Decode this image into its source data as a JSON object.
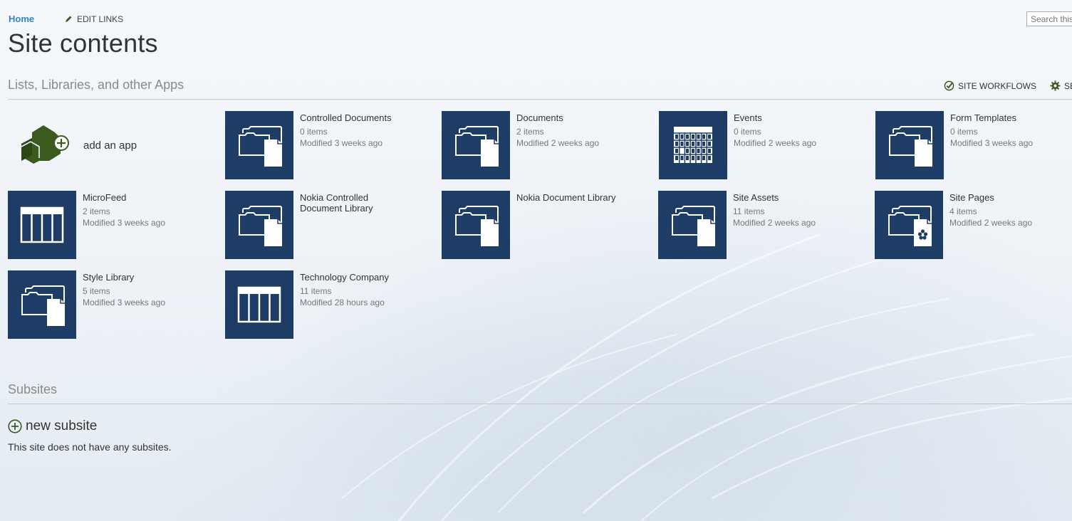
{
  "nav": {
    "home": "Home",
    "edit_links": "EDIT LINKS",
    "search_placeholder": "Search this site"
  },
  "page": {
    "title": "Site contents"
  },
  "apps_section": {
    "heading": "Lists, Libraries, and other Apps",
    "site_workflows": "SITE WORKFLOWS",
    "settings": "SETTINGS",
    "add_app": "add an app"
  },
  "tiles": [
    {
      "title": "Controlled Documents",
      "count": "0 items",
      "modified": "Modified 3 weeks ago",
      "icon": "folder-document-icon"
    },
    {
      "title": "Documents",
      "count": "2 items",
      "modified": "Modified 2 weeks ago",
      "icon": "folder-document-icon"
    },
    {
      "title": "Events",
      "count": "0 items",
      "modified": "Modified 2 weeks ago",
      "icon": "calendar-icon"
    },
    {
      "title": "Form Templates",
      "count": "0 items",
      "modified": "Modified 3 weeks ago",
      "icon": "folder-document-icon"
    },
    {
      "title": "MicroFeed",
      "count": "2 items",
      "modified": "Modified 3 weeks ago",
      "icon": "list-table-icon"
    },
    {
      "title": "Nokia Controlled Document Library",
      "count": "",
      "modified": "",
      "icon": "folder-document-icon"
    },
    {
      "title": "Nokia Document Library",
      "count": "",
      "modified": "",
      "icon": "folder-document-icon"
    },
    {
      "title": "Site Assets",
      "count": "11 items",
      "modified": "Modified 2 weeks ago",
      "icon": "folder-document-icon"
    },
    {
      "title": "Site Pages",
      "count": "4 items",
      "modified": "Modified 2 weeks ago",
      "icon": "folder-page-icon"
    },
    {
      "title": "Style Library",
      "count": "5 items",
      "modified": "Modified 3 weeks ago",
      "icon": "folder-document-icon"
    },
    {
      "title": "Technology Company",
      "count": "11 items",
      "modified": "Modified 28 hours ago",
      "icon": "list-table-icon"
    }
  ],
  "subsites_section": {
    "heading": "Subsites",
    "new_subsite": "new subsite",
    "empty_message": "This site does not have any subsites."
  },
  "colors": {
    "tile_bg": "#1d3c66",
    "add_app_green": "#3b5a1e",
    "link_blue": "#3b7fbf"
  }
}
